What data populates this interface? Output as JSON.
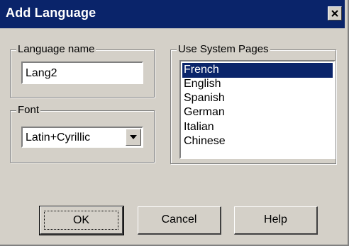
{
  "window": {
    "title": "Add Language",
    "close_icon": "close-x-icon"
  },
  "language_name": {
    "legend": "Language name",
    "value": "Lang2"
  },
  "font": {
    "legend": "Font",
    "selected": "Latin+Cyrillic",
    "dropdown_icon": "chevron-down-icon"
  },
  "system_pages": {
    "legend": "Use System Pages",
    "items": [
      "French",
      "English",
      "Spanish",
      "German",
      "Italian",
      "Chinese"
    ],
    "selected_index": 0
  },
  "buttons": {
    "ok": "OK",
    "cancel": "Cancel",
    "help": "Help"
  },
  "colors": {
    "titlebar": "#0a246a",
    "face": "#d4d0c8",
    "selection": "#0a246a"
  }
}
